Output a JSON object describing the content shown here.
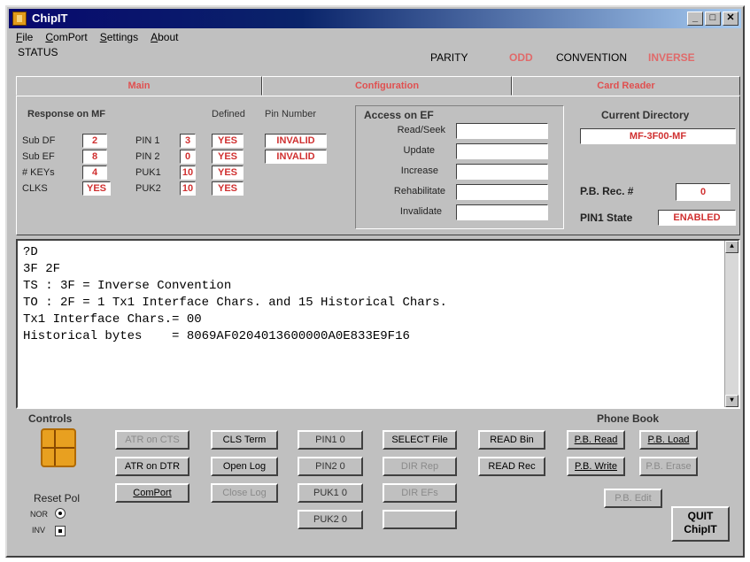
{
  "window": {
    "title": "ChipIT"
  },
  "menu": [
    "File",
    "ComPort",
    "Settings",
    "About"
  ],
  "status": {
    "label": "STATUS",
    "parity_label": "PARITY",
    "parity_value": "ODD",
    "convention_label": "CONVENTION",
    "convention_value": "INVERSE"
  },
  "tabs": [
    "Main",
    "Configuration",
    "Card Reader"
  ],
  "response": {
    "title": "Response on MF",
    "rows": [
      {
        "label": "Sub DF",
        "value": "2"
      },
      {
        "label": "Sub EF",
        "value": "8"
      },
      {
        "label": "# KEYs",
        "value": "4"
      },
      {
        "label": "CLKS",
        "value": "YES"
      }
    ]
  },
  "pins": {
    "defined_header": "Defined",
    "pin_number_header": "Pin Number",
    "rows": [
      {
        "label": "PIN 1",
        "count": "3",
        "defined": "YES",
        "number": "INVALID"
      },
      {
        "label": "PIN 2",
        "count": "0",
        "defined": "YES",
        "number": "INVALID"
      },
      {
        "label": "PUK1",
        "count": "10",
        "defined": "YES",
        "number": ""
      },
      {
        "label": "PUK2",
        "count": "10",
        "defined": "YES",
        "number": ""
      }
    ]
  },
  "access": {
    "title": "Access on EF",
    "rows": [
      "Read/Seek",
      "Update",
      "Increase",
      "Rehabilitate",
      "Invalidate"
    ]
  },
  "directory": {
    "title": "Current Directory",
    "value": "MF-3F00-MF",
    "pb_rec_label": "P.B. Rec. #",
    "pb_rec_value": "0",
    "pin1_state_label": "PIN1 State",
    "pin1_state_value": "ENABLED"
  },
  "console": {
    "lines": [
      "?D",
      "3F 2F",
      "TS : 3F = Inverse Convention",
      "TO : 2F = 1 Tx1 Interface Chars. and 15 Historical Chars.",
      "Tx1 Interface Chars.= 00",
      "Historical bytes    = 8069AF0204013600000A0E833E9F16"
    ]
  },
  "controls": {
    "title": "Controls",
    "reset_pol": "Reset Pol",
    "nor": "NOR",
    "inv": "INV",
    "phone_book": "Phone Book",
    "buttons": {
      "atr_cts": "ATR on CTS",
      "atr_dtr": "ATR on DTR",
      "comport": "ComPort",
      "cls_term": "CLS Term",
      "open_log": "Open Log",
      "close_log": "Close Log",
      "pin1": "PIN1 0",
      "pin2": "PIN2 0",
      "puk1": "PUK1 0",
      "puk2": "PUK2 0",
      "select_file": "SELECT File",
      "dir_rep": "DIR Rep",
      "dir_efs": "DIR EFs",
      "dir4": "",
      "read_bin": "READ Bin",
      "read_rec": "READ Rec",
      "pb_read": "P.B. Read",
      "pb_load": "P.B. Load",
      "pb_write": "P.B. Write",
      "pb_erase": "P.B. Erase",
      "pb_edit": "P.B. Edit",
      "quit": "QUIT",
      "quit2": "ChipIT"
    }
  },
  "colors": {
    "accent_red": "#d03030",
    "title_blue": "#0a246a"
  }
}
